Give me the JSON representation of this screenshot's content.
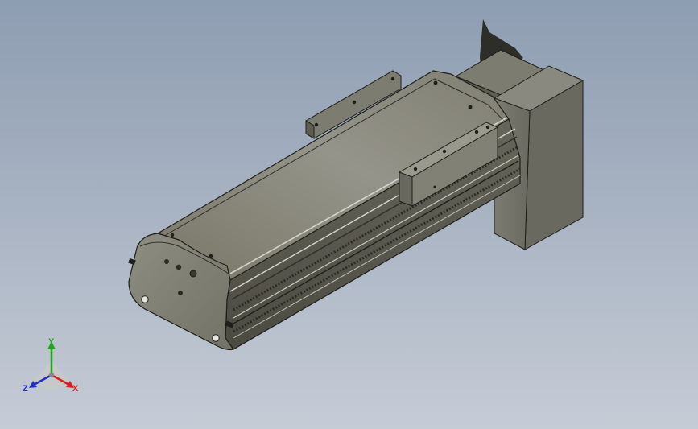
{
  "viewport": {
    "background_top": "#8e9db2",
    "background_bottom": "#c6ccd6",
    "model": "linear-actuator-module"
  },
  "triad": {
    "x_label": "X",
    "y_label": "Y",
    "z_label": "Z",
    "x_color": "#d42020",
    "y_color": "#1fa51f",
    "z_color": "#2030c0"
  }
}
